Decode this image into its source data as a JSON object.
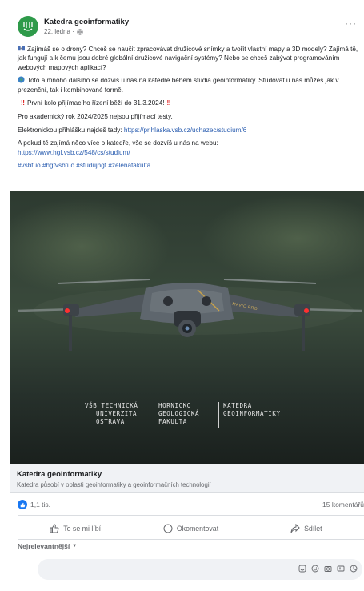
{
  "post": {
    "page_name": "Katedra geoinformatiky",
    "date": "22. ledna ·",
    "more_label": "···",
    "paragraphs": {
      "p1": "Zajímáš se o drony? Chceš se naučit zpracovávat družicové snímky a tvořit vlastní mapy a 3D modely? Zajímá tě, jak fungují a k čemu jsou dobré globální družicové navigační systémy? Nebo se chceš zabývat programováním webových mapových aplikací?",
      "p2": "Toto a mnoho dalšího se dozvíš u nás na katedře během studia geoinformatiky. Studovat u nás můžeš jak v prezenční, tak i kombinované formě.",
      "p3": "První kolo přijímacího řízení běží do 31.3.2024!",
      "p4": "Pro akademický rok 2024/2025 nejsou přijímací testy.",
      "p5_text": "Elektronickou přihlášku najdeš tady:",
      "p5_link": "https://prihlaska.vsb.cz/uchazec/studium/6",
      "p6_text": "A pokud tě zajímá něco více o katedře, vše se dozvíš u nás na webu:",
      "p6_link": "https://www.hgf.vsb.cz/548/cs/studium/",
      "hashtags": "#vsbtuo #hgfvsbtuo #studujhgf #zelenafakulta"
    },
    "photo_overlay": {
      "col1_lines": [
        "VŠB TECHNICKÁ",
        "UNIVERZITA",
        "OSTRAVA"
      ],
      "col2_lines": [
        "HORNICKO",
        "GEOLOGICKÁ",
        "FAKULTA"
      ],
      "col3_lines": [
        "KATEDRA",
        "GEOINFORMATIKY"
      ],
      "drone_brand": "MAVIC PRO"
    },
    "link_preview": {
      "title": "Katedra geoinformatiky",
      "description": "Katedra působí v oblasti geoinformatiky a geoinformačních technologií"
    },
    "stats": {
      "reactions": "1,1 tis.",
      "comments": "15 komentářů"
    },
    "actions": {
      "like": "To se mi líbí",
      "comment": "Okomentovat",
      "share": "Sdílet"
    },
    "sort_label": "Nejrelevantnější"
  },
  "colors": {
    "brand_green": "#2e9a4a",
    "link_blue": "#2a5db0",
    "like_blue": "#1877f2",
    "alert_red": "#e02424"
  }
}
